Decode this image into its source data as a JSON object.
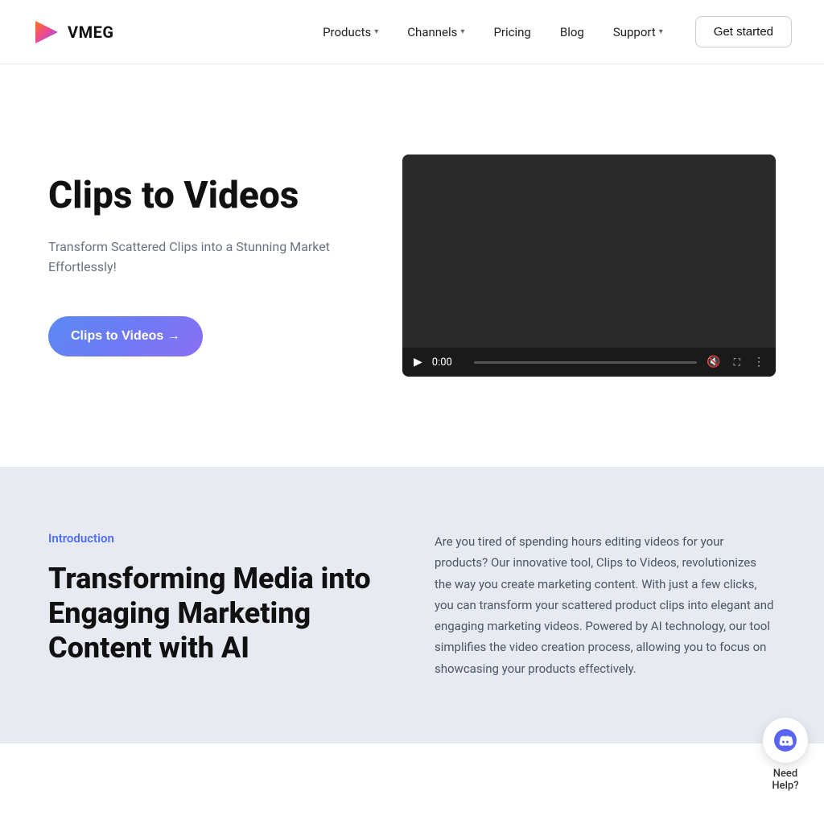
{
  "brand": {
    "name": "VMEG"
  },
  "nav": {
    "items": [
      {
        "label": "Products",
        "hasDropdown": true
      },
      {
        "label": "Channels",
        "hasDropdown": true
      },
      {
        "label": "Pricing",
        "hasDropdown": false
      },
      {
        "label": "Blog",
        "hasDropdown": false
      },
      {
        "label": "Support",
        "hasDropdown": true
      }
    ],
    "cta": "Get started"
  },
  "hero": {
    "title": "Clips to Videos",
    "subtitle": "Transform Scattered Clips into a Stunning Market Effortlessly!",
    "cta_label": "Clips to Videos →",
    "video": {
      "time": "0:00"
    }
  },
  "intro": {
    "label": "Introduction",
    "heading": "Transforming Media into Engaging Marketing Content with AI",
    "body": "Are you tired of spending hours editing videos for your products? Our innovative tool, Clips to Videos, revolutionizes the way you create marketing content. With just a few clicks, you can transform your scattered product clips into elegant and engaging marketing videos. Powered by AI technology, our tool simplifies the video creation process, allowing you to focus on showcasing your products effectively."
  },
  "chat_widget": {
    "label_line1": "Need",
    "label_line2": "Help?"
  }
}
